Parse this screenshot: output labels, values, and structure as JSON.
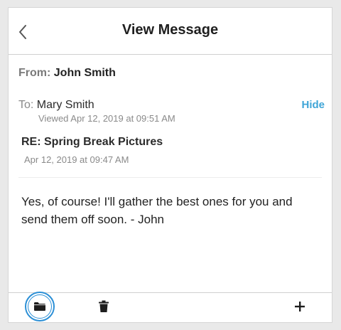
{
  "header": {
    "title": "View Message"
  },
  "message": {
    "from_label": "From:",
    "from_name": "John Smith",
    "to_label": "To:",
    "to_name": "Mary Smith",
    "viewed": "Viewed Apr 12, 2019 at 09:51 AM",
    "hide_label": "Hide",
    "subject": "RE: Spring Break Pictures",
    "date": "Apr 12, 2019 at 09:47 AM",
    "body": "Yes, of course! I'll gather the best ones for you and send them off soon. - John"
  },
  "colors": {
    "accent": "#3fa5d7",
    "focus_ring": "#2b8fd6"
  },
  "footer": {
    "icons": [
      "folder-icon",
      "trash-icon",
      "plus-icon"
    ]
  }
}
